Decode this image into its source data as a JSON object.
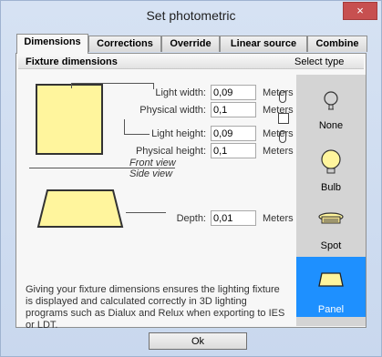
{
  "window": {
    "title": "Set photometric",
    "close": "×"
  },
  "tabs": [
    "Dimensions",
    "Corrections",
    "Override",
    "Linear source",
    "Combine"
  ],
  "group": {
    "title": "Fixture dimensions",
    "select_type": "Select type"
  },
  "fields": {
    "light_width": {
      "label": "Light width:",
      "value": "0,09",
      "unit": "Meters"
    },
    "physical_width": {
      "label": "Physical width:",
      "value": "0,1",
      "unit": "Meters"
    },
    "light_height": {
      "label": "Light height:",
      "value": "0,09",
      "unit": "Meters"
    },
    "physical_height": {
      "label": "Physical height:",
      "value": "0,1",
      "unit": "Meters"
    },
    "depth": {
      "label": "Depth:",
      "value": "0,01",
      "unit": "Meters"
    }
  },
  "views": {
    "front": "Front view",
    "side": "Side view"
  },
  "types": [
    {
      "name": "None",
      "icon": "empty-bulb-icon"
    },
    {
      "name": "Bulb",
      "icon": "bulb-icon"
    },
    {
      "name": "Spot",
      "icon": "spot-icon"
    },
    {
      "name": "Panel",
      "icon": "panel-icon",
      "selected": true
    }
  ],
  "note": "Giving your fixture dimensions ensures the lighting fixture is displayed and calculated correctly in 3D lighting programs such as Dialux and Relux when exporting to IES or LDT.",
  "buttons": {
    "ok": "Ok"
  },
  "colors": {
    "selected": "#1e90ff",
    "fixture_fill": "#fff59d"
  }
}
